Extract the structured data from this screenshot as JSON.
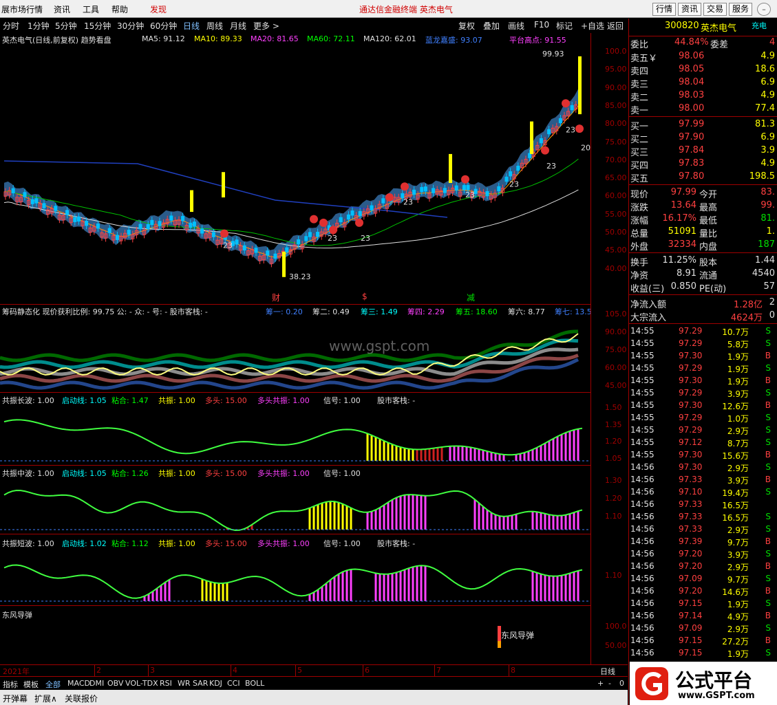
{
  "menu": {
    "items": [
      "展市场行情",
      "资讯",
      "工具",
      "帮助",
      "发现"
    ],
    "title": "通达信金融终端  英杰电气",
    "right_buttons": [
      "行情",
      "资讯",
      "交易",
      "服务"
    ]
  },
  "periods": [
    "分时",
    "1分钟",
    "5分钟",
    "15分钟",
    "30分钟",
    "60分钟",
    "日线",
    "周线",
    "月线",
    "更多 >"
  ],
  "toolbar": [
    "复权",
    "叠加",
    "画线",
    "F10",
    "标记",
    "+自选",
    "返回"
  ],
  "main_chart": {
    "title": "英杰电气(日线,前复权) 趋势看盘",
    "ma": [
      {
        "label": "MA5: 91.12",
        "color": "#e0e0e0"
      },
      {
        "label": "MA10: 89.33",
        "color": "#ffff00"
      },
      {
        "label": "MA20: 81.65",
        "color": "#ff40ff"
      },
      {
        "label": "MA60: 72.11",
        "color": "#00ff00"
      },
      {
        "label": "MA120: 62.01",
        "color": "#e0e0e0"
      },
      {
        "label": "蓝龙嘉盛: 93.07",
        "color": "#4080ff"
      },
      {
        "label": "平台高点: 91.55",
        "color": "#ff40ff"
      }
    ],
    "y_ticks": [
      "100.0",
      "95.00",
      "90.00",
      "85.00",
      "80.00",
      "75.00",
      "70.00",
      "65.00",
      "60.00",
      "55.00",
      "50.00",
      "45.00",
      "40.00"
    ],
    "high_label": "99.93",
    "low_label": "38.23",
    "markers": [
      "23",
      "23",
      "23",
      "23",
      "23",
      "23",
      "23",
      "23",
      "20"
    ],
    "events": [
      "财",
      "$",
      "减"
    ]
  },
  "chip_chart": {
    "title": "筹码静态化 现价获利比例: 99.75 公: - 众: - 号: - 股市客栈: -",
    "legend": [
      "筹一: 0.20",
      "筹二: 0.49",
      "筹三: 1.49",
      "筹四: 2.29",
      "筹五: 18.60",
      "筹六: 8.77",
      "筹七: 13.5"
    ],
    "y_ticks": [
      "105.0",
      "90.00",
      "75.00",
      "60.00",
      "45.00"
    ],
    "watermark": "www.gspt.com"
  },
  "long_wave": {
    "title": "共振长波: 1.00",
    "legend": [
      "启动线: 1.05",
      "粘合: 1.47",
      "共振: 1.00",
      "多头: 15.00",
      "多头共振: 1.00",
      "信号: 1.00",
      "股市客栈: -"
    ],
    "y_ticks": [
      "1.50",
      "1.35",
      "1.20",
      "1.05"
    ]
  },
  "mid_wave": {
    "title": "共振中波: 1.00",
    "legend": [
      "启动线: 1.05",
      "粘合: 1.26",
      "共振: 1.00",
      "多头: 15.00",
      "多头共振: 1.00",
      "信号: 1.00"
    ],
    "y_ticks": [
      "1.30",
      "1.20",
      "1.10"
    ]
  },
  "short_wave": {
    "title": "共振短波: 1.00",
    "legend": [
      "启动线: 1.02",
      "粘合: 1.12",
      "共振: 1.00",
      "多头: 15.00",
      "多头共振: 1.00",
      "信号: 1.00",
      "股市客栈: -"
    ],
    "y_ticks": [
      "1.10"
    ]
  },
  "dongfeng": {
    "title": "东风导弹",
    "label": "东风导弹",
    "y_ticks": [
      "100.0",
      "50.00"
    ]
  },
  "date_axis": {
    "year": "2021年",
    "months": [
      "2",
      "3",
      "4",
      "5",
      "6",
      "7",
      "8"
    ],
    "period_label": "日线"
  },
  "indicator_tabs": [
    "指标",
    "模板",
    "全部",
    "MACD",
    "DMI",
    "OBV",
    "VOL-TDX",
    "RSI",
    "WR",
    "SAR",
    "KDJ",
    "CCI",
    "BOLL"
  ],
  "bottom_tabs": [
    "开弹幕",
    "扩展∧",
    "关联报价"
  ],
  "quote": {
    "code": "300820",
    "name": "英杰电气",
    "badge": "充电",
    "weibi_label": "委比",
    "weibi": "44.84%",
    "weicha_label": "委差",
    "weicha": "4",
    "sell": [
      {
        "label": "卖五￥",
        "price": "98.06",
        "vol": "4.9"
      },
      {
        "label": "卖四",
        "price": "98.05",
        "vol": "18.6"
      },
      {
        "label": "卖三",
        "price": "98.04",
        "vol": "6.9"
      },
      {
        "label": "卖二",
        "price": "98.03",
        "vol": "4.9"
      },
      {
        "label": "卖一",
        "price": "98.00",
        "vol": "77.4"
      }
    ],
    "buy": [
      {
        "label": "买一",
        "price": "97.99",
        "vol": "81.3"
      },
      {
        "label": "买二",
        "price": "97.90",
        "vol": "6.9"
      },
      {
        "label": "买三",
        "price": "97.84",
        "vol": "3.9"
      },
      {
        "label": "买四",
        "price": "97.83",
        "vol": "4.9"
      },
      {
        "label": "买五",
        "price": "97.80",
        "vol": "198.5"
      }
    ],
    "stats": [
      {
        "l1": "现价",
        "v1": "97.99",
        "l2": "今开",
        "v2": "83."
      },
      {
        "l1": "涨跌",
        "v1": "13.64",
        "l2": "最高",
        "v2": "99."
      },
      {
        "l1": "涨幅",
        "v1": "16.17%",
        "l2": "最低",
        "v2": "81."
      },
      {
        "l1": "总量",
        "v1": "51091",
        "l2": "量比",
        "v2": "1."
      },
      {
        "l1": "外盘",
        "v1": "32334",
        "l2": "内盘",
        "v2": "187"
      }
    ],
    "stats2": [
      {
        "l1": "换手",
        "v1": "11.25%",
        "l2": "股本",
        "v2": "1.44"
      },
      {
        "l1": "净资",
        "v1": "8.91",
        "l2": "流通",
        "v2": "4540"
      },
      {
        "l1": "收益(三)",
        "v1": "0.850",
        "l2": "PE(动)",
        "v2": "57"
      }
    ],
    "flow": [
      {
        "label": "净流入额",
        "value": "1.28亿",
        "extra": "2"
      },
      {
        "label": "大宗流入",
        "value": "4624万",
        "extra": "0"
      }
    ],
    "ticks": [
      {
        "t": "14:55",
        "p": "97.29",
        "v": "10.7万",
        "d": "S"
      },
      {
        "t": "14:55",
        "p": "97.29",
        "v": "5.8万",
        "d": "S"
      },
      {
        "t": "14:55",
        "p": "97.30",
        "v": "1.9万",
        "d": "B"
      },
      {
        "t": "14:55",
        "p": "97.29",
        "v": "1.9万",
        "d": "S"
      },
      {
        "t": "14:55",
        "p": "97.30",
        "v": "1.9万",
        "d": "B"
      },
      {
        "t": "14:55",
        "p": "97.29",
        "v": "3.9万",
        "d": "S"
      },
      {
        "t": "14:55",
        "p": "97.30",
        "v": "12.6万",
        "d": "B"
      },
      {
        "t": "14:55",
        "p": "97.29",
        "v": "1.0万",
        "d": "S"
      },
      {
        "t": "14:55",
        "p": "97.29",
        "v": "2.9万",
        "d": "S"
      },
      {
        "t": "14:55",
        "p": "97.12",
        "v": "8.7万",
        "d": "S"
      },
      {
        "t": "14:55",
        "p": "97.30",
        "v": "15.6万",
        "d": "B"
      },
      {
        "t": "14:56",
        "p": "97.30",
        "v": "2.9万",
        "d": "S"
      },
      {
        "t": "14:56",
        "p": "97.33",
        "v": "3.9万",
        "d": "B"
      },
      {
        "t": "14:56",
        "p": "97.10",
        "v": "19.4万",
        "d": "S"
      },
      {
        "t": "14:56",
        "p": "97.33",
        "v": "16.5万",
        "d": ""
      },
      {
        "t": "14:56",
        "p": "97.33",
        "v": "16.5万",
        "d": "S"
      },
      {
        "t": "14:56",
        "p": "97.33",
        "v": "2.9万",
        "d": "S"
      },
      {
        "t": "14:56",
        "p": "97.39",
        "v": "9.7万",
        "d": "B"
      },
      {
        "t": "14:56",
        "p": "97.20",
        "v": "3.9万",
        "d": "S"
      },
      {
        "t": "14:56",
        "p": "97.20",
        "v": "2.9万",
        "d": "B"
      },
      {
        "t": "14:56",
        "p": "97.09",
        "v": "9.7万",
        "d": "S"
      },
      {
        "t": "14:56",
        "p": "97.20",
        "v": "14.6万",
        "d": "B"
      },
      {
        "t": "14:56",
        "p": "97.15",
        "v": "1.9万",
        "d": "S"
      },
      {
        "t": "14:56",
        "p": "97.14",
        "v": "4.9万",
        "d": "B"
      },
      {
        "t": "14:56",
        "p": "97.09",
        "v": "2.9万",
        "d": "S"
      },
      {
        "t": "14:56",
        "p": "97.15",
        "v": "27.2万",
        "d": "B"
      },
      {
        "t": "14:56",
        "p": "97.15",
        "v": "1.9万",
        "d": "S"
      }
    ]
  },
  "logo": {
    "cn": "公式平台",
    "url": "www.GSPT.com"
  },
  "colors": {
    "up": "#ff4040",
    "down": "#00e000",
    "frame": "#a00000",
    "accent": "#ffff00"
  }
}
